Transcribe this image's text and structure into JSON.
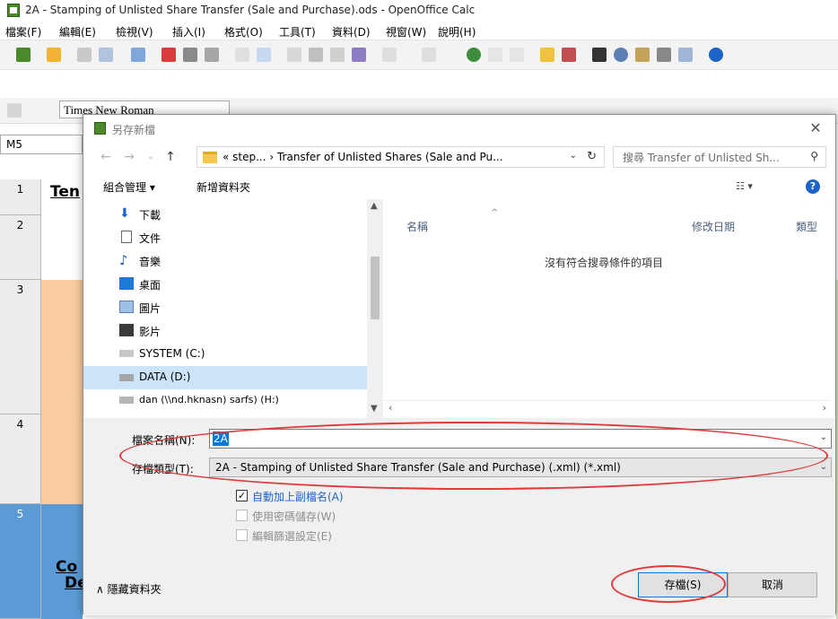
{
  "window": {
    "title": "2A - Stamping of Unlisted Share Transfer (Sale and Purchase).ods - OpenOffice Calc"
  },
  "menubar": [
    "檔案(F)",
    "編輯(E)",
    "檢視(V)",
    "插入(I)",
    "格式(O)",
    "工具(T)",
    "資料(D)",
    "視窗(W)",
    "說明(H)"
  ],
  "formatting": {
    "font_name": "Times New Roman",
    "cell_ref": "M5"
  },
  "sheet": {
    "rows": [
      "1",
      "2",
      "3",
      "4",
      "5"
    ],
    "cell_texts": [
      "Ten",
      "Co",
      "De"
    ],
    "colors": {
      "peach": "#f8cba0",
      "blue": "#5b9bd5",
      "green": "#cfe6b6"
    }
  },
  "dialog": {
    "title": "另存新檔",
    "path_text": "« step...  ›  Transfer of Unlisted Shares (Sale and Pu...",
    "search_placeholder": "搜尋 Transfer of Unlisted Sh...",
    "organize": "組合管理 ▾",
    "new_folder": "新增資料夾",
    "nav_items": [
      {
        "label": "下載",
        "icon": "download-icon"
      },
      {
        "label": "文件",
        "icon": "document-icon"
      },
      {
        "label": "音樂",
        "icon": "music-icon"
      },
      {
        "label": "桌面",
        "icon": "desktop-icon"
      },
      {
        "label": "圖片",
        "icon": "pictures-icon"
      },
      {
        "label": "影片",
        "icon": "videos-icon"
      },
      {
        "label": "SYSTEM (C:)",
        "icon": "system-drive-icon"
      },
      {
        "label": "DATA (D:)",
        "icon": "data-drive-icon",
        "selected": true
      },
      {
        "label": "dan (\\\\nd.hknasn) sarfs) (H:)",
        "icon": "network-drive-icon"
      }
    ],
    "columns": {
      "name": "名稱",
      "modified": "修改日期",
      "type": "類型"
    },
    "empty_message": "沒有符合搜尋條件的項目",
    "file_name_label": "檔案名稱(N):",
    "file_name_value": "2A",
    "file_type_label": "存檔類型(T):",
    "file_type_value": "2A - Stamping of Unlisted Share Transfer (Sale and Purchase) (.xml) (*.xml)",
    "checkboxes": [
      {
        "label": "自動加上副檔名(A)",
        "checked": true,
        "enabled": true
      },
      {
        "label": "使用密碼儲存(W)",
        "checked": false,
        "enabled": false
      },
      {
        "label": "編輯篩選設定(E)",
        "checked": false,
        "enabled": false
      }
    ],
    "hide_folders": "隱藏資料夾",
    "save_button": "存檔(S)",
    "cancel_button": "取消"
  },
  "annotation_color": "#e03a3a"
}
